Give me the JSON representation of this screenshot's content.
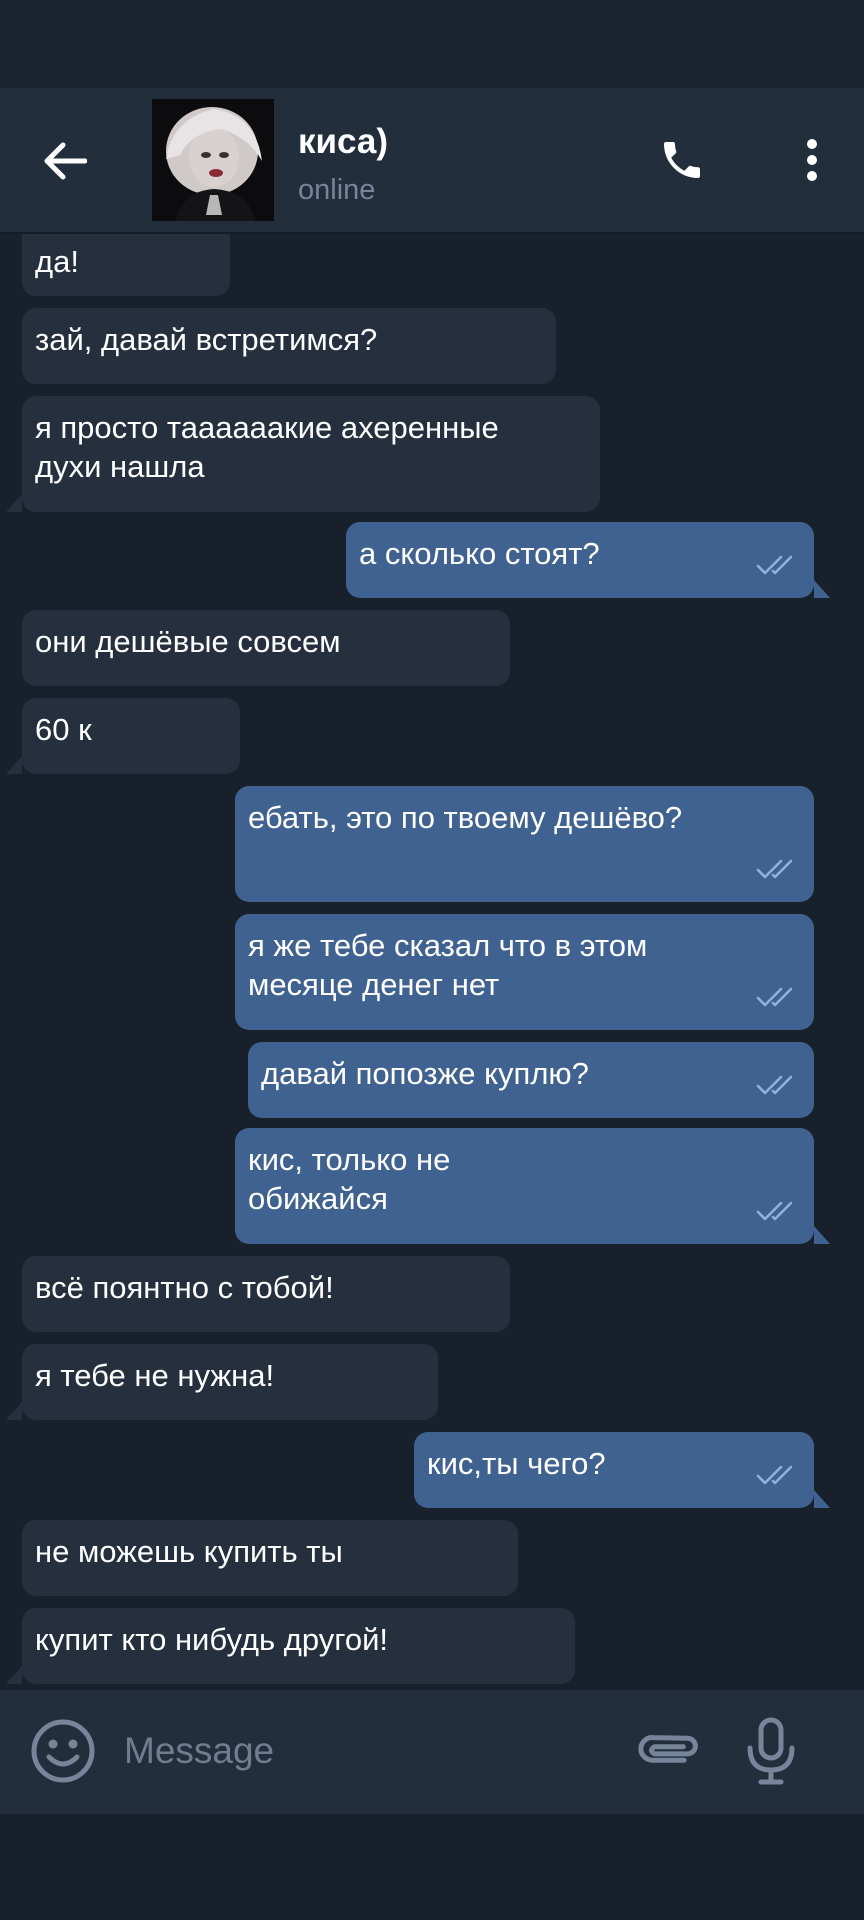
{
  "header": {
    "name": "киса)",
    "status": "online"
  },
  "messages": [
    {
      "dir": "in",
      "text": "да!"
    },
    {
      "dir": "in",
      "text": "зай, давай встретимся?"
    },
    {
      "dir": "in",
      "text": "я просто таааааакие ахеренные\nдухи нашла"
    },
    {
      "dir": "out",
      "text": "а сколько стоят?",
      "read": true
    },
    {
      "dir": "in",
      "text": "они дешёвые совсем"
    },
    {
      "dir": "in",
      "text": "60 к"
    },
    {
      "dir": "out",
      "text": "ебать, это по твоему дешёво?",
      "read": true
    },
    {
      "dir": "out",
      "text": "я же тебе сказал что в этом\nмесяце денег нет",
      "read": true
    },
    {
      "dir": "out",
      "text": "давай попозже куплю?",
      "read": true
    },
    {
      "dir": "out",
      "text": "кис, только не\nобижайся",
      "read": true
    },
    {
      "dir": "in",
      "text": "всё поянтно с тобой!"
    },
    {
      "dir": "in",
      "text": "я тебе не нужна!"
    },
    {
      "dir": "out",
      "text": "кис,ты чего?",
      "read": true
    },
    {
      "dir": "in",
      "text": "не можешь купить ты"
    },
    {
      "dir": "in",
      "text": "купит кто нибудь другой!"
    }
  ],
  "input": {
    "placeholder": "Message"
  },
  "icons": {
    "back": "arrow-left-icon",
    "call": "phone-icon",
    "more": "more-vertical-icon",
    "emoji": "emoji-icon",
    "attach": "paperclip-icon",
    "mic": "microphone-icon",
    "read": "double-check-icon"
  },
  "colors": {
    "incoming_bubble": "#252f3e",
    "outgoing_bubble": "#3f6290",
    "background": "#18202b",
    "header": "#232e3d",
    "read_check": "#8fb2dd"
  }
}
